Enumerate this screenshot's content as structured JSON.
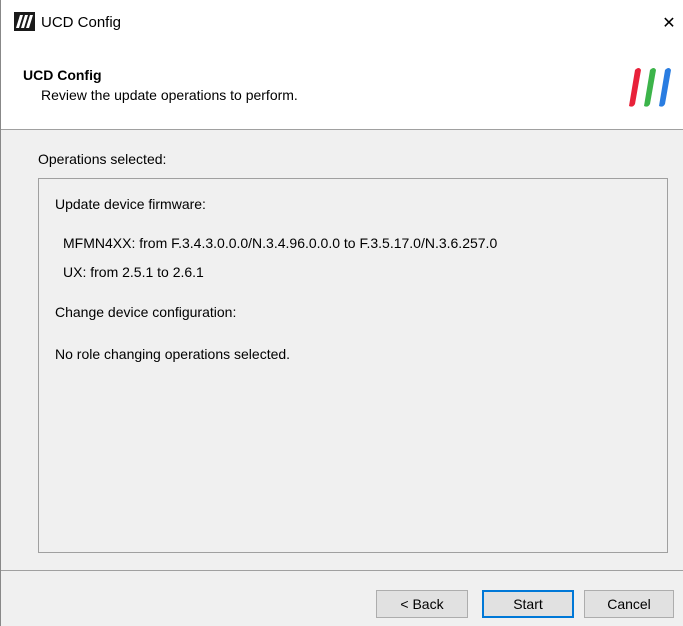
{
  "window": {
    "title": "UCD Config",
    "close_glyph": "✕"
  },
  "header": {
    "title": "UCD Config",
    "subtitle": "Review the update operations to perform."
  },
  "operations": {
    "label": "Operations selected:",
    "firmware_heading": "Update device firmware:",
    "firmware_items": [
      "MFMN4XX: from F.3.4.3.0.0.0/N.3.4.96.0.0.0 to F.3.5.17.0/N.3.6.257.0",
      "UX: from 2.5.1 to 2.6.1"
    ],
    "config_heading": "Change device configuration:",
    "config_items": [
      "No role changing operations selected."
    ]
  },
  "buttons": {
    "back": "< Back",
    "start": "Start",
    "cancel": "Cancel"
  },
  "icons": {
    "app": "ucd-app-icon",
    "logo": "brand-stripes-logo",
    "close": "close-icon"
  },
  "colors": {
    "logo_red": "#e8213a",
    "logo_green": "#3cb44a",
    "logo_blue": "#2a7de1",
    "default_button_border": "#0078d7"
  }
}
